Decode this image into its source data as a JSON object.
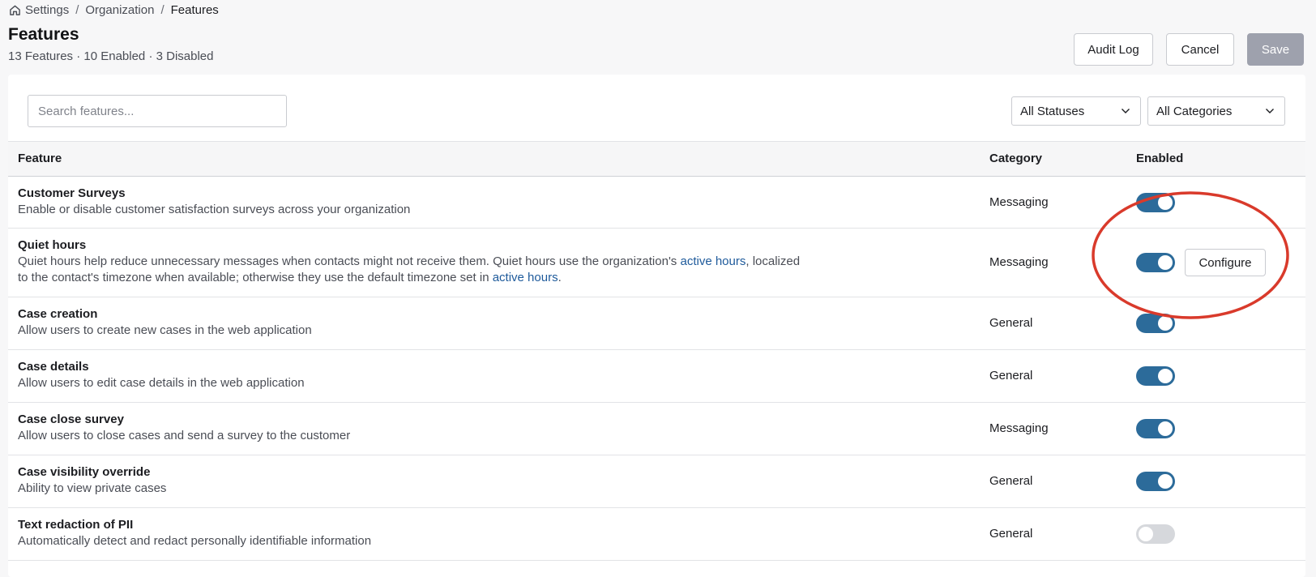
{
  "breadcrumb": {
    "items": [
      "Settings",
      "Organization",
      "Features"
    ],
    "separator": "/"
  },
  "page": {
    "title": "Features",
    "summary": "13 Features · 10 Enabled · 3 Disabled"
  },
  "actions": {
    "audit_log": "Audit Log",
    "cancel": "Cancel",
    "save": "Save"
  },
  "filters": {
    "search_placeholder": "Search features...",
    "status_selected": "All Statuses",
    "category_selected": "All Categories"
  },
  "table": {
    "headers": {
      "feature": "Feature",
      "category": "Category",
      "enabled": "Enabled"
    },
    "rows": [
      {
        "name": "Customer Surveys",
        "description": "Enable or disable customer satisfaction surveys across your organization",
        "category": "Messaging",
        "enabled": true
      },
      {
        "name": "Quiet hours",
        "description_parts": [
          "Quiet hours help reduce unnecessary messages when contacts might not receive them. Quiet hours use the organization's ",
          "active hours",
          ", localized",
          "to the contact's timezone when available; otherwise they use the default timezone set in ",
          "active hours",
          "."
        ],
        "category": "Messaging",
        "enabled": true,
        "action_label": "Configure"
      },
      {
        "name": "Case creation",
        "description": "Allow users to create new cases in the web application",
        "category": "General",
        "enabled": true
      },
      {
        "name": "Case details",
        "description": "Allow users to edit case details in the web application",
        "category": "General",
        "enabled": true
      },
      {
        "name": "Case close survey",
        "description": "Allow users to close cases and send a survey to the customer",
        "category": "Messaging",
        "enabled": true
      },
      {
        "name": "Case visibility override",
        "description": "Ability to view private cases",
        "category": "General",
        "enabled": true
      },
      {
        "name": "Text redaction of PII",
        "description": "Automatically detect and redact personally identifiable information",
        "category": "General",
        "enabled": false
      }
    ]
  },
  "colors": {
    "toggle_on": "#2c6b9a",
    "toggle_off": "#d6d8dc",
    "link": "#1e5a9b",
    "save_disabled": "#9ea1ad",
    "highlight": "#d93a2b"
  },
  "icons": {
    "home": "home-icon",
    "chevron": "chevron-down-icon"
  }
}
